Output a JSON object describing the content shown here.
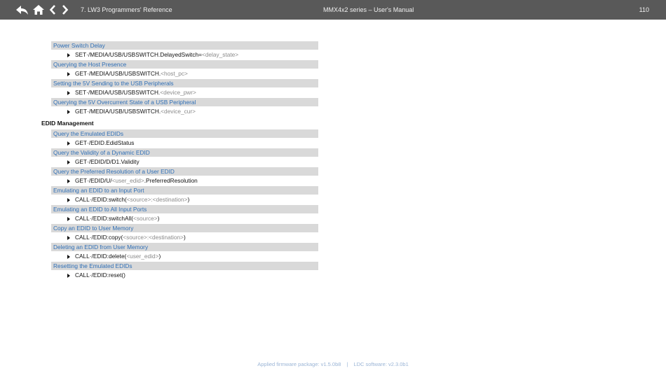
{
  "header": {
    "chapter": "7. LW3 Programmers' Reference",
    "manual": "MMX4x2 series – User's Manual",
    "page": "110"
  },
  "nav": {
    "icons": [
      "undo-back-icon",
      "home-icon",
      "chevron-left-icon",
      "chevron-right-icon"
    ]
  },
  "groups_usb": [
    {
      "title": "Power Switch Delay",
      "prefix": "SET·/MEDIA/USB/USBSWITCH.DelayedSwitch=",
      "param": "<delay_state>",
      "suffix": ""
    },
    {
      "title": "Querying the Host Presence",
      "prefix": "GET·/MEDIA/USB/USBSWITCH.",
      "param": "<host_pc>",
      "suffix": ""
    },
    {
      "title": "Setting the 5V Sending to the USB Peripherals",
      "prefix": "SET·/MEDIA/USB/USBSWITCH.",
      "param": "<device_pwr>",
      "suffix": ""
    },
    {
      "title": "Querying the 5V Overcurrent State of a USB Peripheral",
      "prefix": "GET·/MEDIA/USB/USBSWITCH.",
      "param": "<device_cur>",
      "suffix": ""
    }
  ],
  "edid_section_title": "EDID Management",
  "groups_edid": [
    {
      "title": "Query the Emulated EDIDs",
      "prefix": "GET·/EDID.EdidStatus",
      "param": "",
      "suffix": ""
    },
    {
      "title": "Query the Validity of a Dynamic EDID",
      "prefix": "GET·/EDID/D/D1.Validity",
      "param": "",
      "suffix": ""
    },
    {
      "title": "Query the Preferred Resolution of a User EDID",
      "prefix": "GET·/EDID/U/",
      "param": "<user_edid>",
      "suffix": ".PreferredResolution"
    },
    {
      "title": "Emulating an EDID to an Input Port",
      "prefix": "CALL·/EDID:switch(",
      "param": "<source>:<destination>",
      "suffix": ")"
    },
    {
      "title": "Emulating an EDID to All Input Ports",
      "prefix": "CALL·/EDID:switchAll(",
      "param": "<source>",
      "suffix": ")"
    },
    {
      "title": "Copy an EDID to User Memory",
      "prefix": "CALL·/EDID:copy(",
      "param": "<source>:<destination>",
      "suffix": ")"
    },
    {
      "title": "Deleting an EDID from User Memory",
      "prefix": "CALL·/EDID:delete(",
      "param": "<user_edid>",
      "suffix": ")"
    },
    {
      "title": "Resetting the Emulated EDIDs",
      "prefix": "CALL·/EDID:reset()",
      "param": "",
      "suffix": ""
    }
  ],
  "footer": {
    "firmware": "Applied firmware package: v1.5.0b8",
    "separator": "|",
    "ldc": "LDC software: v2.3.0b1"
  },
  "colors": {
    "topbar": "#595959",
    "link": "#2f6fb6",
    "group_bg": "#d9d9d9",
    "param": "#8a8a8a",
    "footer": "#9bb5d6"
  }
}
